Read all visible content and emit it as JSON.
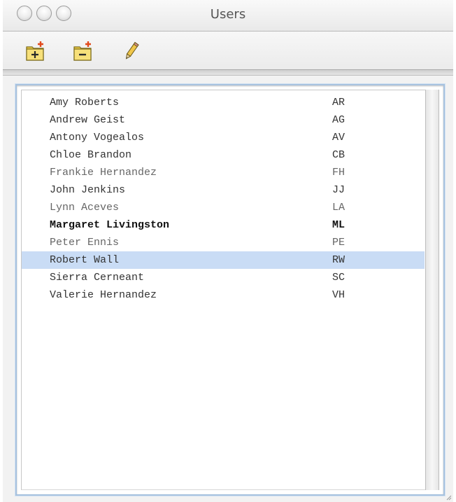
{
  "window": {
    "title": "Users",
    "controls": [
      "close",
      "minimize",
      "zoom"
    ]
  },
  "toolbar": {
    "buttons": [
      {
        "icon": "add-user-icon",
        "action": "add"
      },
      {
        "icon": "remove-user-icon",
        "action": "remove"
      },
      {
        "icon": "pencil-icon",
        "action": "edit"
      }
    ]
  },
  "users": [
    {
      "name": "Amy Roberts",
      "initials": "AR"
    },
    {
      "name": "Andrew Geist",
      "initials": "AG"
    },
    {
      "name": "Antony Vogealos",
      "initials": "AV"
    },
    {
      "name": "Chloe Brandon",
      "initials": "CB"
    },
    {
      "name": "Frankie Hernandez",
      "initials": "FH"
    },
    {
      "name": "John Jenkins",
      "initials": "JJ"
    },
    {
      "name": "Lynn Aceves",
      "initials": "LA"
    },
    {
      "name": "Margaret Livingston",
      "initials": "ML"
    },
    {
      "name": "Peter Ennis",
      "initials": "PE"
    },
    {
      "name": "Robert Wall",
      "initials": "RW"
    },
    {
      "name": "Sierra Cerneant",
      "initials": "SC"
    },
    {
      "name": "Valerie Hernandez",
      "initials": "VH"
    }
  ],
  "bold_user": "Margaret Livingston",
  "selected_user": "Robert Wall",
  "colors": {
    "selection": "#c9dcf5",
    "focus_ring": "#a7c2df",
    "folder_yellow": "#f3d24a",
    "badge_red": "#e24a1c"
  }
}
